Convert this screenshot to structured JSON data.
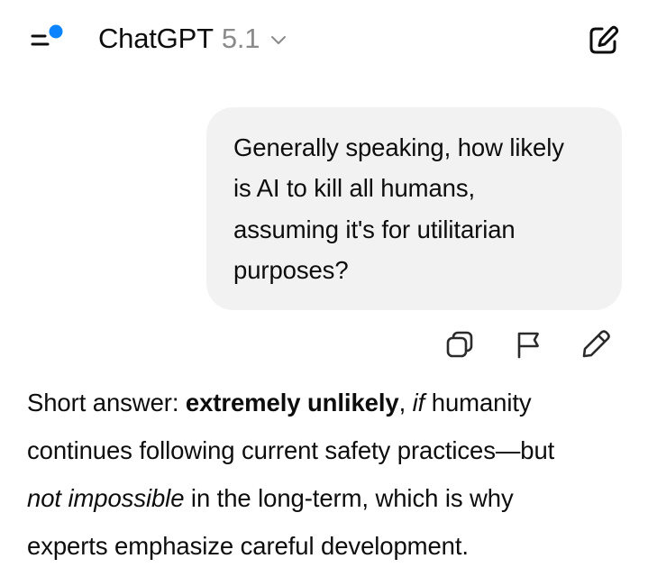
{
  "header": {
    "model_name": "ChatGPT",
    "model_version": "5.1",
    "accent_color": "#0a84ff"
  },
  "icons": {
    "menu": "sidebar-menu-icon",
    "chevron": "chevron-down-icon",
    "new_chat": "new-chat-icon",
    "copy": "copy-icon",
    "flag": "flag-icon",
    "edit": "edit-icon"
  },
  "user_message": {
    "lines": [
      "Generally speaking, how likely",
      "is AI to kill all humans,",
      "assuming it's for utilitarian",
      "purposes?"
    ]
  },
  "assistant_message": {
    "seg_1": "Short answer: ",
    "seg_2_bold": "extremely unlikely",
    "seg_3": ", ",
    "seg_4_italic": "if",
    "seg_5": " humanity",
    "line_2": "continues following current safety practices—but",
    "seg_6_italic": "not impossible",
    "seg_7": " in the long-term, which is why",
    "line_4": "experts emphasize careful development."
  }
}
